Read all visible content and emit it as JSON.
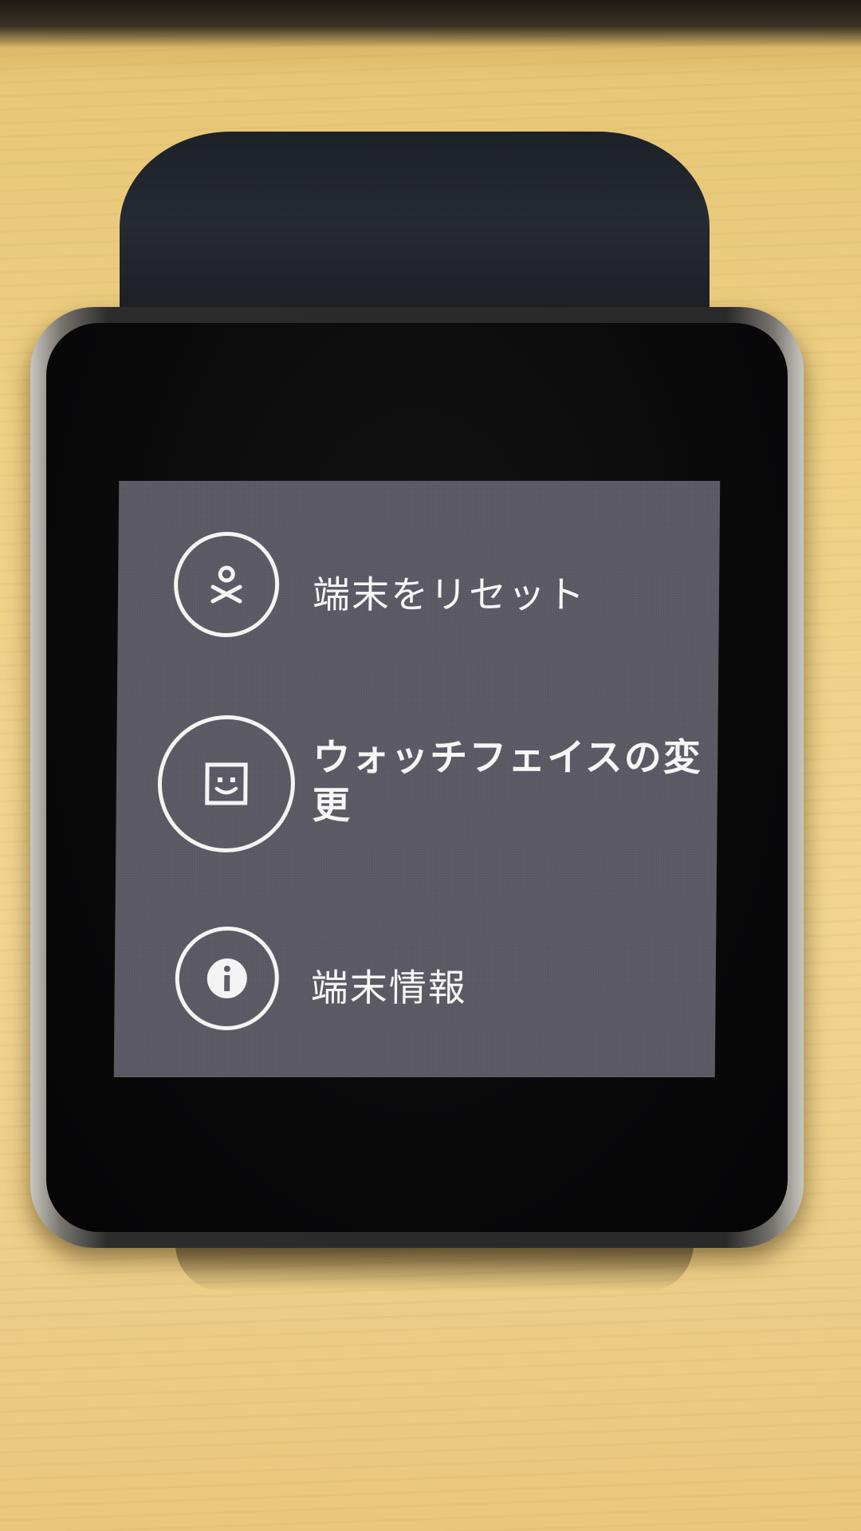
{
  "menu": {
    "items": [
      {
        "label": "端末をリセット",
        "icon": "person-reset-icon"
      },
      {
        "label": "ウォッチフェイスの変更",
        "icon": "smiley-face-icon"
      },
      {
        "label": "端末情報",
        "icon": "info-icon"
      }
    ]
  },
  "colors": {
    "screen_bg": "#5f5d67",
    "text": "#f6f6f6",
    "bezel": "#0a0a0b",
    "table": "#f0d186"
  }
}
